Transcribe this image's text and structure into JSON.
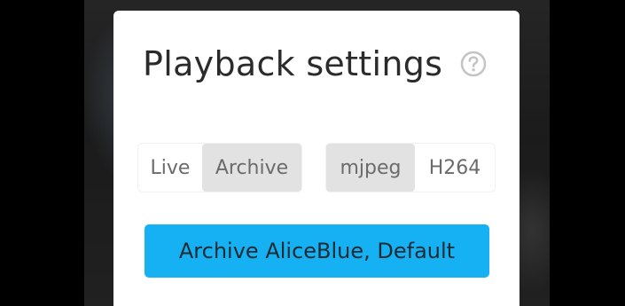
{
  "dialog": {
    "title": "Playback settings",
    "help_icon": "question-circle-icon"
  },
  "source_toggle": {
    "options": [
      {
        "label": "Live",
        "selected": false
      },
      {
        "label": "Archive",
        "selected": true
      }
    ]
  },
  "codec_toggle": {
    "options": [
      {
        "label": "mjpeg",
        "selected": true
      },
      {
        "label": "H264",
        "selected": false
      }
    ]
  },
  "primary_button": {
    "label": "Archive AliceBlue, Default"
  },
  "colors": {
    "accent": "#16b1f2",
    "selected_segment": "#e2e2e2",
    "dialog_bg": "#ffffff"
  }
}
